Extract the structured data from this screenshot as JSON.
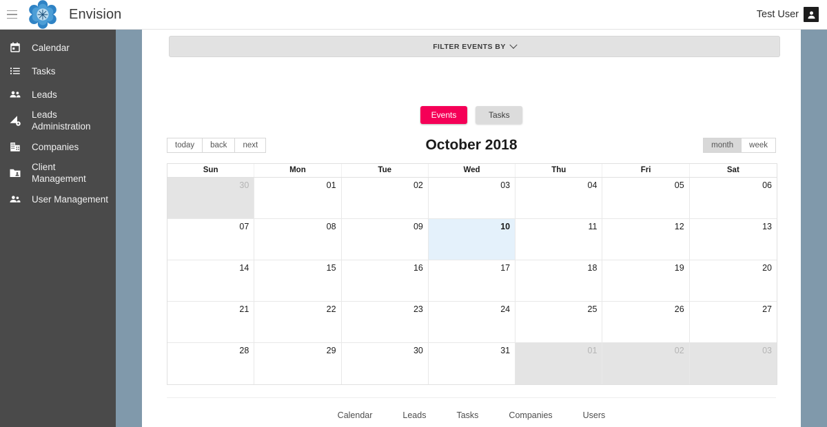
{
  "header": {
    "menu_icon": "hamburger-icon",
    "logo_icon": "envision-flower-logo",
    "title": "Envision",
    "user_name": "Test User",
    "user_icon": "user-avatar-icon"
  },
  "sidebar": {
    "items": [
      {
        "label": "Calendar",
        "icon": "calendar-icon"
      },
      {
        "label": "Tasks",
        "icon": "list-icon"
      },
      {
        "label": "Leads",
        "icon": "people-icon"
      },
      {
        "label": "Leads\nAdministration",
        "icon": "leads-admin-gear-icon"
      },
      {
        "label": "Companies",
        "icon": "building-icon"
      },
      {
        "label": "Client\nManagement",
        "icon": "client-folder-icon"
      },
      {
        "label": "User Management",
        "icon": "user-management-icon"
      }
    ]
  },
  "main": {
    "filter_bar": {
      "label": "FILTER EVENTS BY",
      "chevron_icon": "chevron-down-icon"
    },
    "mode_toggle": {
      "events_label": "Events",
      "tasks_label": "Tasks",
      "active": "Events",
      "active_color": "#f50057",
      "inactive_color": "#dcdcdc"
    },
    "calendar": {
      "title": "October 2018",
      "nav_buttons": [
        "today",
        "back",
        "next"
      ],
      "view_buttons": [
        "month",
        "week"
      ],
      "active_view": "month",
      "weekdays": [
        "Sun",
        "Mon",
        "Tue",
        "Wed",
        "Thu",
        "Fri",
        "Sat"
      ],
      "today_date": "10",
      "today_bg": "#e4f1fb",
      "off_month_bg": "#e4e4e4",
      "weeks": [
        [
          {
            "day": "30",
            "off": true
          },
          {
            "day": "01",
            "off": false
          },
          {
            "day": "02",
            "off": false
          },
          {
            "day": "03",
            "off": false
          },
          {
            "day": "04",
            "off": false
          },
          {
            "day": "05",
            "off": false
          },
          {
            "day": "06",
            "off": false
          }
        ],
        [
          {
            "day": "07",
            "off": false
          },
          {
            "day": "08",
            "off": false
          },
          {
            "day": "09",
            "off": false
          },
          {
            "day": "10",
            "off": false,
            "today": true
          },
          {
            "day": "11",
            "off": false
          },
          {
            "day": "12",
            "off": false
          },
          {
            "day": "13",
            "off": false
          }
        ],
        [
          {
            "day": "14",
            "off": false
          },
          {
            "day": "15",
            "off": false
          },
          {
            "day": "16",
            "off": false
          },
          {
            "day": "17",
            "off": false
          },
          {
            "day": "18",
            "off": false
          },
          {
            "day": "19",
            "off": false
          },
          {
            "day": "20",
            "off": false
          }
        ],
        [
          {
            "day": "21",
            "off": false
          },
          {
            "day": "22",
            "off": false
          },
          {
            "day": "23",
            "off": false
          },
          {
            "day": "24",
            "off": false
          },
          {
            "day": "25",
            "off": false
          },
          {
            "day": "26",
            "off": false
          },
          {
            "day": "27",
            "off": false
          }
        ],
        [
          {
            "day": "28",
            "off": false
          },
          {
            "day": "29",
            "off": false
          },
          {
            "day": "30",
            "off": false
          },
          {
            "day": "31",
            "off": false
          },
          {
            "day": "01",
            "off": true
          },
          {
            "day": "02",
            "off": true
          },
          {
            "day": "03",
            "off": true
          }
        ]
      ]
    }
  },
  "footer": {
    "links": [
      "Calendar",
      "Leads",
      "Tasks",
      "Companies",
      "Users"
    ]
  },
  "theme": {
    "sidebar_bg": "#4a4a4a",
    "accent_strip": "#8099ab",
    "accent_pink": "#f50057"
  }
}
